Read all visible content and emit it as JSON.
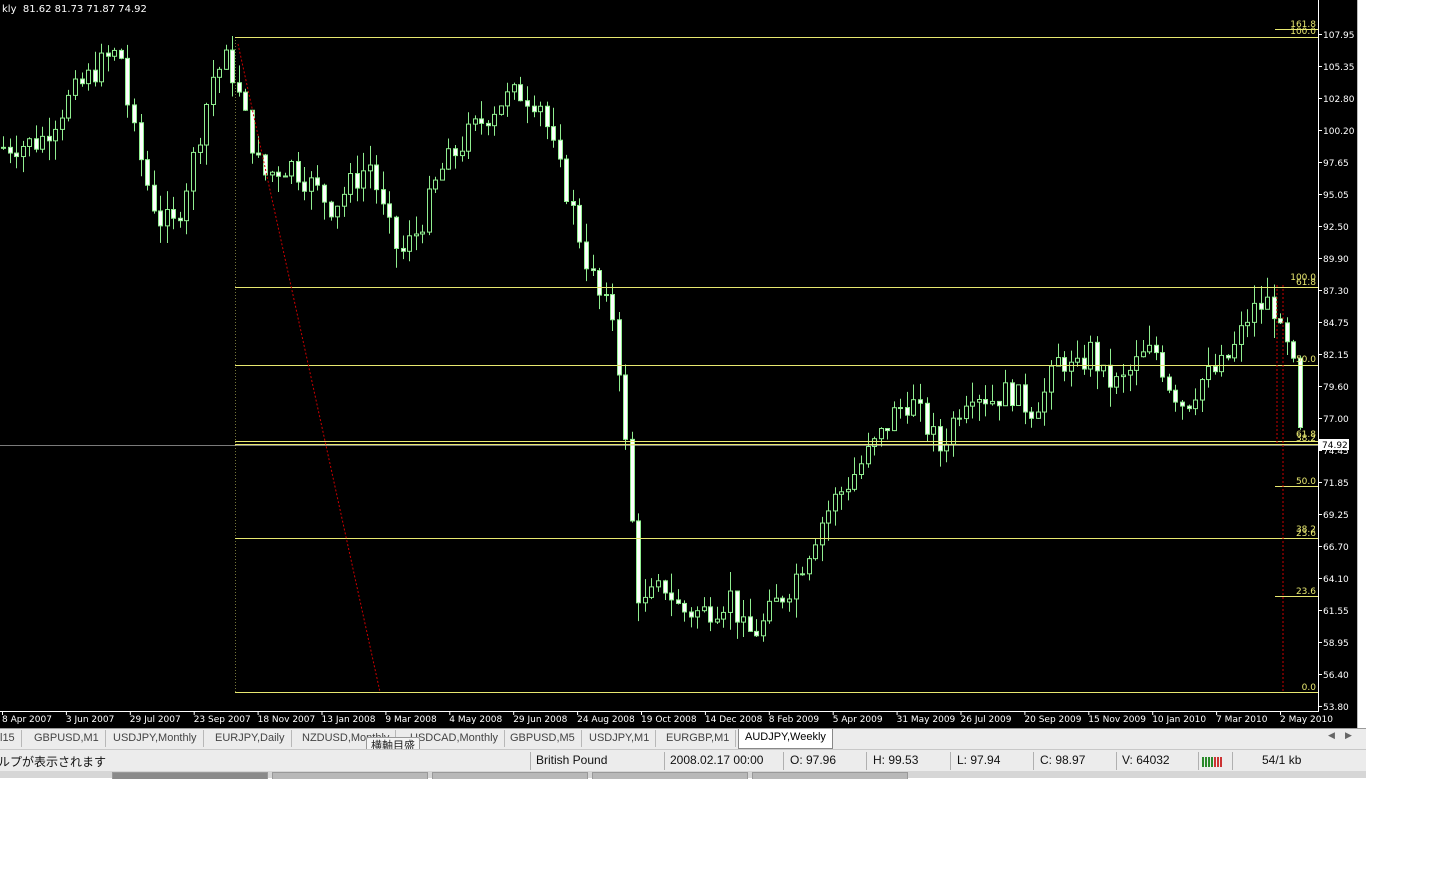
{
  "window": {
    "title_partial": "kly",
    "ohlc_header": "81.62 81.73 71.87 74.92"
  },
  "chart": {
    "symbol": "AUDJPY",
    "timeframe": "Weekly",
    "type": "candlestick",
    "current_price": "74.92",
    "colors": {
      "background": "#000000",
      "candle": "#90ee90",
      "bull_body": "#000000",
      "bear_body": "#ffffff",
      "fibo": "#e8e870",
      "trendline": "#cc0000"
    },
    "price_axis": [
      "107.95",
      "105.35",
      "102.80",
      "100.20",
      "97.65",
      "95.05",
      "92.50",
      "89.90",
      "87.30",
      "84.75",
      "82.15",
      "79.60",
      "77.00",
      "74.45",
      "71.85",
      "69.25",
      "66.70",
      "64.10",
      "61.55",
      "58.95",
      "56.40",
      "53.80"
    ],
    "time_axis": [
      "8 Apr 2007",
      "3 Jun 2007",
      "29 Jul 2007",
      "23 Sep 2007",
      "18 Nov 2007",
      "13 Jan 2008",
      "9 Mar 2008",
      "4 May 2008",
      "29 Jun 2008",
      "24 Aug 2008",
      "19 Oct 2008",
      "14 Dec 2008",
      "8 Feb 2009",
      "5 Apr 2009",
      "31 May 2009",
      "26 Jul 2009",
      "20 Sep 2009",
      "15 Nov 2009",
      "10 Jan 2010",
      "7 Mar 2010",
      "2 May 2010"
    ],
    "fibo_labels": {
      "top_161": "161.8",
      "top_100": "100.0",
      "mid_100": "100.0",
      "mid_618": "61.8",
      "lvl_500": "50.0",
      "lvl_618b": "61.8",
      "lvl_382b": "38.2",
      "low_500": "50.0",
      "low_382": "38.2",
      "low_236a": "23.6",
      "low_236": "23.6",
      "low_00": "0.0"
    }
  },
  "tabs": {
    "items": [
      "l15",
      "GBPUSD,M1",
      "USDJPY,Monthly",
      "EURJPY,Daily",
      "NZDUSD,Monthly",
      "USDCAD,Monthly",
      "GBPUSD,M5",
      "USDJPY,M1",
      "EURGBP,M1",
      "AUDJPY,Weekly"
    ],
    "active_index": 9,
    "tooltip": "横軸目盛"
  },
  "status_bar": {
    "help_text": "ルプが表示されます",
    "instrument": "British Pound",
    "datetime": "2008.02.17 00:00",
    "open": "O: 97.96",
    "high": "H: 99.53",
    "low": "L: 97.94",
    "close": "C: 98.97",
    "volume": "V: 64032",
    "traffic": "54/1 kb"
  }
}
